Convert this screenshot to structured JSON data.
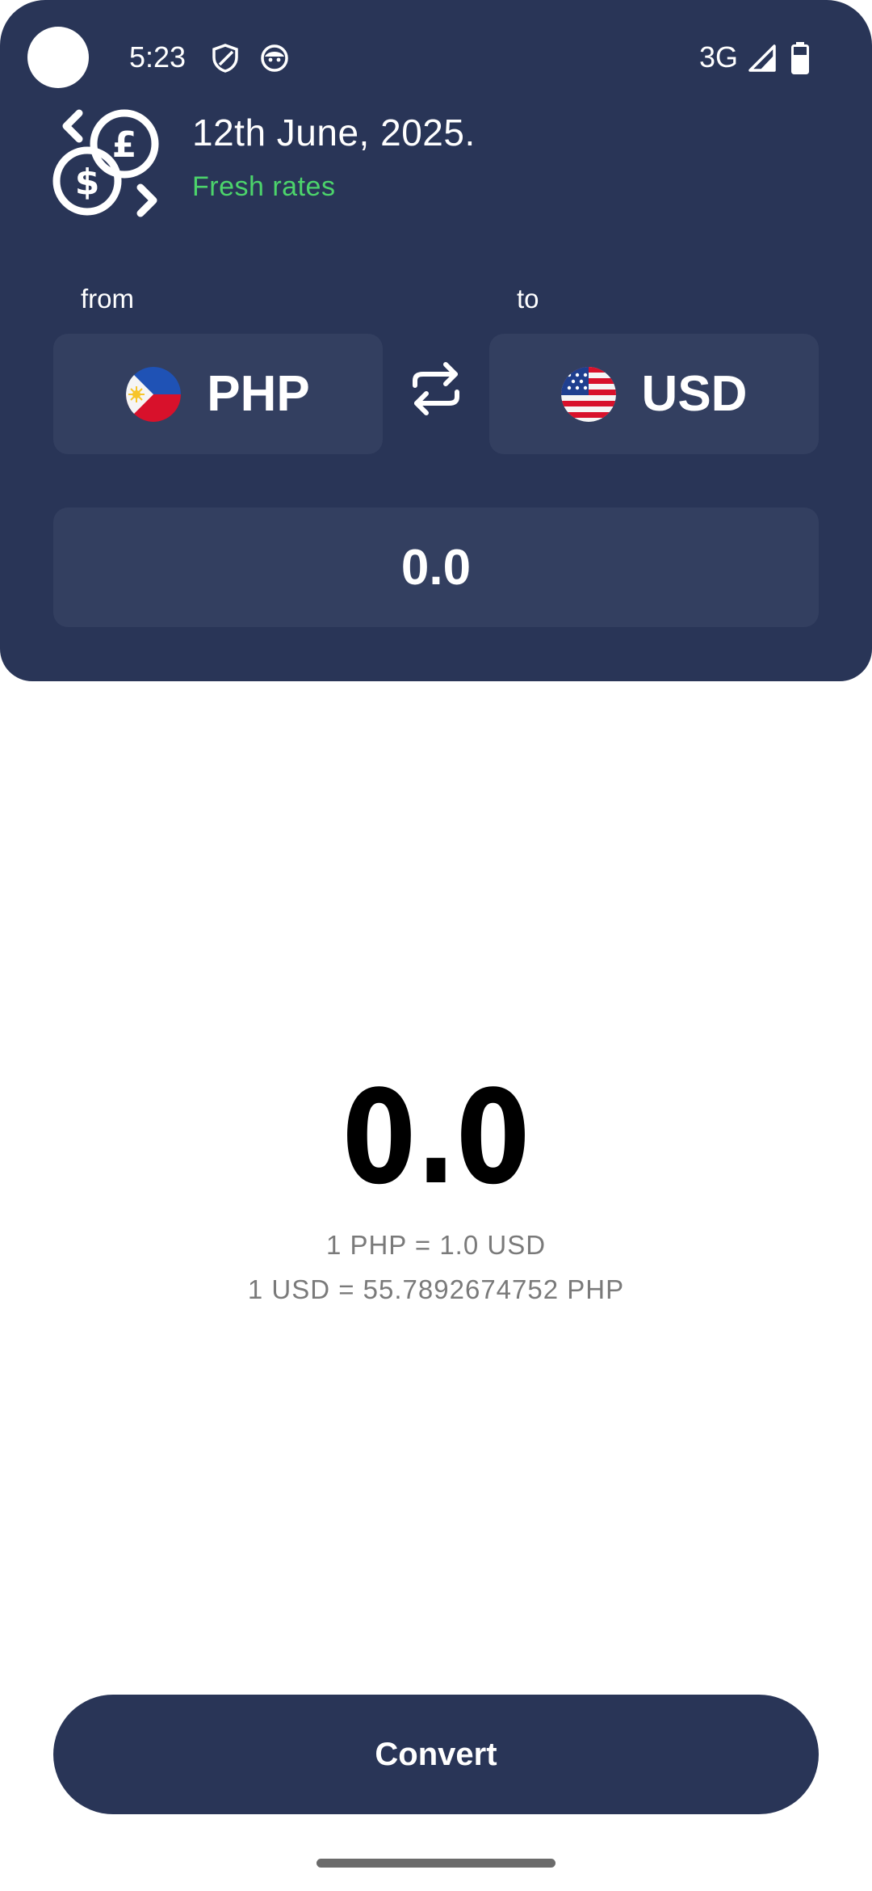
{
  "status_bar": {
    "time": "5:23",
    "network": "3G",
    "icons": [
      "shield-icon",
      "face-icon",
      "signal-icon",
      "battery-icon"
    ]
  },
  "header": {
    "logo_icon": "currency-exchange-icon",
    "date": "12th June, 2025.",
    "status": "Fresh rates",
    "status_color": "#4cd46b"
  },
  "converter": {
    "from_label": "from",
    "to_label": "to",
    "from_currency": "PHP",
    "to_currency": "USD",
    "from_flag": "philippines-flag-icon",
    "to_flag": "usa-flag-icon",
    "swap_icon": "swap-icon",
    "amount": "0.0"
  },
  "result": {
    "value": "0.0",
    "rate_forward": "1 PHP = 1.0 USD",
    "rate_reverse": "1 USD = 55.7892674752 PHP"
  },
  "actions": {
    "convert_label": "Convert"
  },
  "colors": {
    "primary": "#293557",
    "field": "#333f60",
    "accent_green": "#4cd46b"
  }
}
